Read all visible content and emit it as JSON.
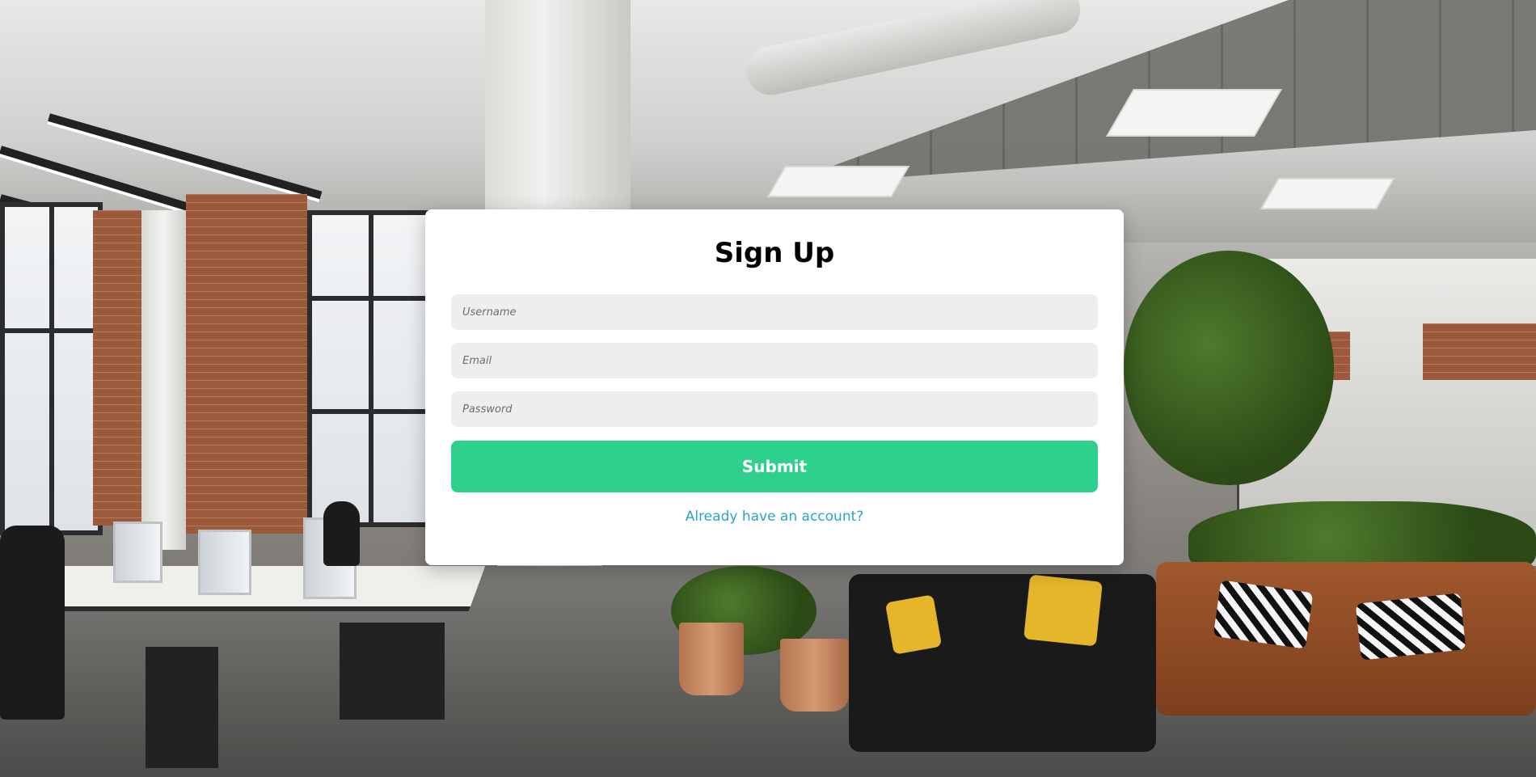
{
  "background": {
    "image": "office-interior-photo"
  },
  "form": {
    "title": "Sign Up",
    "username_placeholder": "Username",
    "email_placeholder": "Email",
    "password_placeholder": "Password",
    "submit_label": "Submit",
    "login_link_label": "Already have an account?"
  },
  "colors": {
    "submit_button": "#2ed18c",
    "link": "#2aa6c9",
    "field_background": "#eeeeee",
    "card_background": "#ffffff"
  }
}
